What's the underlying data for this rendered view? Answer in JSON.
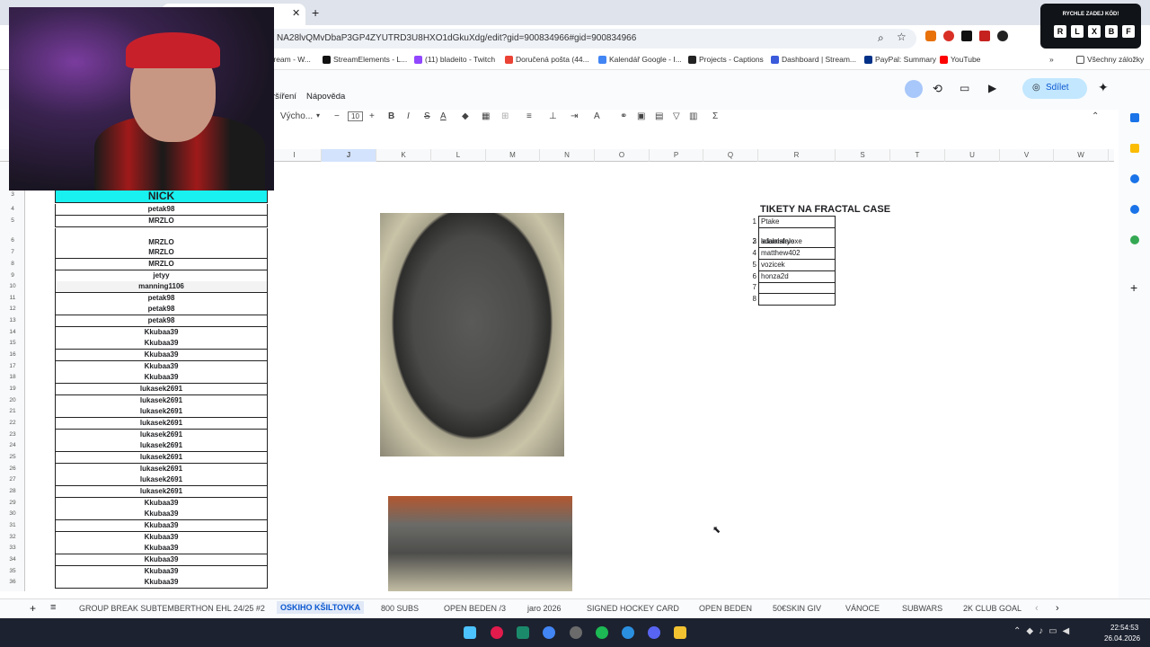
{
  "browser": {
    "url": "NA28lvQMvDbaP3GP4ZYUTRD3U8HXO1dGkuXdg/edit?gid=900834966#gid=900834966"
  },
  "bookmarks": [
    {
      "label": "tream - W..."
    },
    {
      "label": "StreamElements - L..."
    },
    {
      "label": "(11) bladeito - Twitch"
    },
    {
      "label": "Doručená pošta (44..."
    },
    {
      "label": "Kalendář Google - I..."
    },
    {
      "label": "Projects - Captions"
    },
    {
      "label": "Dashboard | Stream..."
    },
    {
      "label": "PayPal: Summary"
    },
    {
      "label": "YouTube"
    },
    {
      "label": "Všechny záložky"
    }
  ],
  "menu": {
    "item1": "ršíření",
    "item2": "Nápověda"
  },
  "toolbar": {
    "font": "Výcho...",
    "size": "10"
  },
  "share_label": "Sdílet",
  "columns": [
    "I",
    "J",
    "K",
    "L",
    "M",
    "N",
    "O",
    "P",
    "Q",
    "R",
    "S",
    "T",
    "U",
    "V",
    "W"
  ],
  "nick_header": "NICK",
  "rows": [
    {
      "n": "3",
      "nick": ""
    },
    {
      "n": "4",
      "nick": "petak98"
    },
    {
      "n": "5",
      "nick": "MRZLO"
    },
    {
      "n": "6",
      "nick": "MRZLO"
    },
    {
      "n": "7",
      "nick": "MRZLO"
    },
    {
      "n": "8",
      "nick": "MRZLO"
    },
    {
      "n": "9",
      "nick": "jetyy"
    },
    {
      "n": "10",
      "nick": "manning1106"
    },
    {
      "n": "11",
      "nick": "petak98"
    },
    {
      "n": "12",
      "nick": "petak98"
    },
    {
      "n": "13",
      "nick": "petak98"
    },
    {
      "n": "14",
      "nick": "Kkubaa39"
    },
    {
      "n": "15",
      "nick": "Kkubaa39"
    },
    {
      "n": "16",
      "nick": "Kkubaa39"
    },
    {
      "n": "17",
      "nick": "Kkubaa39"
    },
    {
      "n": "18",
      "nick": "Kkubaa39"
    },
    {
      "n": "19",
      "nick": "lukasek2691"
    },
    {
      "n": "20",
      "nick": "lukasek2691"
    },
    {
      "n": "21",
      "nick": "lukasek2691"
    },
    {
      "n": "22",
      "nick": "lukasek2691"
    },
    {
      "n": "23",
      "nick": "lukasek2691"
    },
    {
      "n": "24",
      "nick": "lukasek2691"
    },
    {
      "n": "25",
      "nick": "lukasek2691"
    },
    {
      "n": "26",
      "nick": "lukasek2691"
    },
    {
      "n": "27",
      "nick": "lukasek2691"
    },
    {
      "n": "28",
      "nick": "lukasek2691"
    },
    {
      "n": "29",
      "nick": "Kkubaa39"
    },
    {
      "n": "30",
      "nick": "Kkubaa39"
    },
    {
      "n": "31",
      "nick": "Kkubaa39"
    },
    {
      "n": "32",
      "nick": "Kkubaa39"
    },
    {
      "n": "33",
      "nick": "Kkubaa39"
    },
    {
      "n": "34",
      "nick": "Kkubaa39"
    },
    {
      "n": "35",
      "nick": "Kkubaa39"
    },
    {
      "n": "36",
      "nick": "Kkubaa39"
    }
  ],
  "tickets": {
    "title": "TIKETY NA FRACTAL CASE",
    "items": [
      {
        "n": "1",
        "name": "Ptake"
      },
      {
        "n": "2",
        "name": "adamsfryexe"
      },
      {
        "n": "3",
        "name": "lalalalalalo"
      },
      {
        "n": "4",
        "name": "matthew402"
      },
      {
        "n": "5",
        "name": "vozicek"
      },
      {
        "n": "6",
        "name": "honza2d"
      },
      {
        "n": "7",
        "name": ""
      },
      {
        "n": "8",
        "name": ""
      }
    ]
  },
  "sheet_tabs": [
    "GROUP BREAK SUBTEMBERTHON EHL 24/25 #2",
    "OSKIHO KŠILTOVKA",
    "800 SUBS",
    "OPEN BEDEN /3",
    "jaro 2026",
    "SIGNED HOCKEY CARD",
    "OPEN BEDEN",
    "50€SKIN GIV",
    "VÁNOCE",
    "SUBWARS",
    "2K CLUB GOAL"
  ],
  "active_tab": "OSKIHO KŠILTOVKA",
  "code_overlay": {
    "label": "RYCHLE ZADEJ KÓD!",
    "chars": [
      "R",
      "L",
      "X",
      "B",
      "F"
    ]
  },
  "clock": {
    "time": "22:54:53",
    "date": "26.04.2026"
  },
  "colors": {
    "nick_header": "#19f0f0",
    "accent": "#0b57d0"
  }
}
